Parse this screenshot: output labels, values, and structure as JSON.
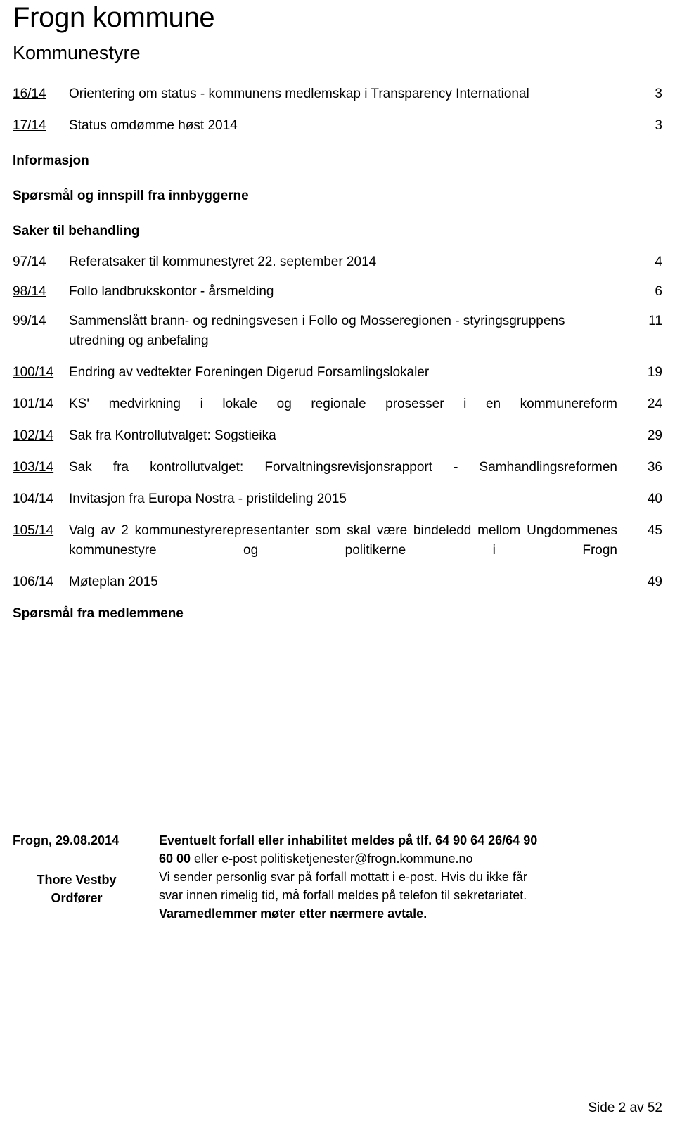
{
  "document": {
    "title": "Frogn kommune",
    "subtitle": "Kommunestyre",
    "page_number": "Side 2 av 52"
  },
  "toc": {
    "entries": [
      {
        "number": "16/14",
        "title": "Orientering om status - kommunens medlemskap i Transparency International",
        "page": "3",
        "justify": false
      },
      {
        "number": "17/14",
        "title": "Status omdømme høst 2014",
        "page": "3",
        "justify": false
      }
    ],
    "headings": [
      {
        "label": "Informasjon"
      },
      {
        "label": "Spørsmål og innspill fra innbyggerne"
      },
      {
        "label": "Saker til behandling"
      }
    ],
    "entries2": [
      {
        "number": "97/14",
        "title": "Referatsaker til kommunestyret 22. september 2014",
        "page": "4",
        "justify": false
      },
      {
        "number": "98/14",
        "title": "Follo landbrukskontor - årsmelding",
        "page": "6",
        "justify": false
      },
      {
        "number": "99/14",
        "title": "Sammenslått brann- og redningsvesen i Follo og Mosseregionen - styringsgruppens utredning og anbefaling",
        "page": "11",
        "justify": false
      },
      {
        "number": "100/14",
        "title": "Endring av vedtekter Foreningen Digerud Forsamlingslokaler",
        "page": "19",
        "justify": false
      },
      {
        "number": "101/14",
        "title": "KS' medvirkning i lokale og regionale prosesser i en kommunereform",
        "page": "24",
        "justify": true
      },
      {
        "number": "102/14",
        "title": "Sak fra Kontrollutvalget: Sogstieika",
        "page": "29",
        "justify": false
      },
      {
        "number": "103/14",
        "title": "Sak fra kontrollutvalget: Forvaltningsrevisjonsrapport - Samhandlingsreformen",
        "page": "36",
        "justify": true
      },
      {
        "number": "104/14",
        "title": "Invitasjon fra Europa Nostra - pristildeling 2015",
        "page": "40",
        "justify": false
      },
      {
        "number": "105/14",
        "title": "Valg av 2 kommunestyrerepresentanter som skal være bindeledd mellom Ungdommenes kommunestyre og politikerne i Frogn",
        "page": "45",
        "justify": true
      },
      {
        "number": "106/14",
        "title": "Møteplan 2015",
        "page": "49",
        "justify": false
      }
    ],
    "heading_last": "Spørsmål fra medlemmene"
  },
  "footer": {
    "place_date": "Frogn, 29.08.2014",
    "signer_name": "Thore Vestby",
    "signer_title": "Ordfører",
    "line1": "Eventuelt forfall eller inhabilitet meldes på tlf. 64 90 64 26/64 90",
    "line2_bold": "60 00",
    "line2_rest": " eller e-post politisketjenester@frogn.kommune.no",
    "line3": "Vi sender personlig svar på forfall mottatt i e-post. Hvis du ikke får",
    "line4": "svar innen rimelig tid, må forfall meldes på telefon til sekretariatet.",
    "line5": "Varamedlemmer møter etter nærmere avtale."
  }
}
